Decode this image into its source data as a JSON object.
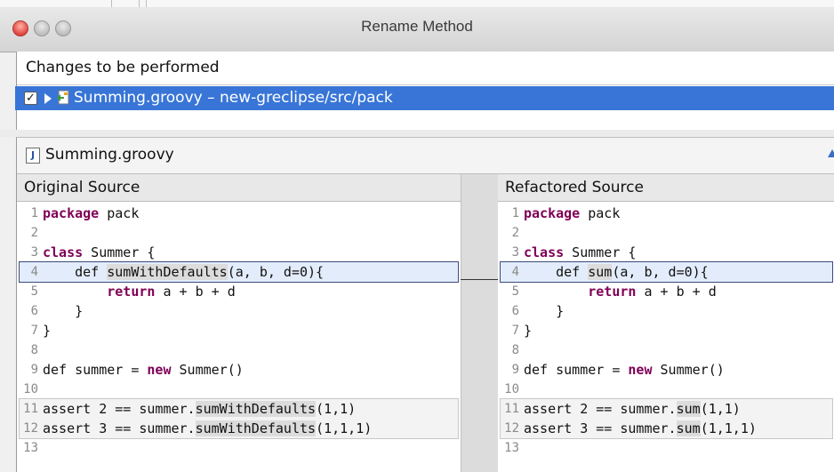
{
  "window": {
    "title": "Rename Method"
  },
  "changes": {
    "header": "Changes to be performed",
    "item": {
      "checked": true,
      "label": "Summing.groovy – new-greclipse/src/pack",
      "icon": "groovy-file-icon"
    }
  },
  "compare": {
    "file_label": "Summing.groovy",
    "left_title": "Original Source",
    "right_title": "Refactored Source",
    "left_lines": [
      {
        "n": "1",
        "parts": [
          [
            "package",
            "kw"
          ],
          [
            " pack",
            ""
          ]
        ]
      },
      {
        "n": "2",
        "parts": []
      },
      {
        "n": "3",
        "parts": [
          [
            "class",
            "kw"
          ],
          [
            " Summer {",
            ""
          ]
        ]
      },
      {
        "n": "4",
        "parts": [
          [
            "    def ",
            ""
          ],
          [
            "sumWithDefaults",
            "hl"
          ],
          [
            "(a, b, d=0){",
            ""
          ]
        ]
      },
      {
        "n": "5",
        "parts": [
          [
            "        ",
            ""
          ],
          [
            "return",
            "kw"
          ],
          [
            " a + b + d",
            ""
          ]
        ]
      },
      {
        "n": "6",
        "parts": [
          [
            "    }",
            ""
          ]
        ]
      },
      {
        "n": "7",
        "parts": [
          [
            "}",
            ""
          ]
        ]
      },
      {
        "n": "8",
        "parts": []
      },
      {
        "n": "9",
        "parts": [
          [
            "def summer = ",
            ""
          ],
          [
            "new",
            "kw"
          ],
          [
            " Summer()",
            ""
          ]
        ]
      },
      {
        "n": "10",
        "parts": []
      },
      {
        "n": "11",
        "parts": [
          [
            "assert 2 == summer.",
            ""
          ],
          [
            "sumWithDefaults",
            "hl"
          ],
          [
            "(1,1)",
            ""
          ]
        ]
      },
      {
        "n": "12",
        "parts": [
          [
            "assert 3 == summer.",
            ""
          ],
          [
            "sumWithDefaults",
            "hl"
          ],
          [
            "(1,1,1)",
            ""
          ]
        ]
      },
      {
        "n": "13",
        "parts": []
      }
    ],
    "right_lines": [
      {
        "n": "1",
        "parts": [
          [
            "package",
            "kw"
          ],
          [
            " pack",
            ""
          ]
        ]
      },
      {
        "n": "2",
        "parts": []
      },
      {
        "n": "3",
        "parts": [
          [
            "class",
            "kw"
          ],
          [
            " Summer {",
            ""
          ]
        ]
      },
      {
        "n": "4",
        "parts": [
          [
            "    def ",
            ""
          ],
          [
            "sum",
            "hl"
          ],
          [
            "(a, b, d=0){",
            ""
          ]
        ]
      },
      {
        "n": "5",
        "parts": [
          [
            "        ",
            ""
          ],
          [
            "return",
            "kw"
          ],
          [
            " a + b + d",
            ""
          ]
        ]
      },
      {
        "n": "6",
        "parts": [
          [
            "    }",
            ""
          ]
        ]
      },
      {
        "n": "7",
        "parts": [
          [
            "}",
            ""
          ]
        ]
      },
      {
        "n": "8",
        "parts": []
      },
      {
        "n": "9",
        "parts": [
          [
            "def summer = ",
            ""
          ],
          [
            "new",
            "kw"
          ],
          [
            " Summer()",
            ""
          ]
        ]
      },
      {
        "n": "10",
        "parts": []
      },
      {
        "n": "11",
        "parts": [
          [
            "assert 2 == summer.",
            ""
          ],
          [
            "sum",
            "hl"
          ],
          [
            "(1,1)",
            ""
          ]
        ]
      },
      {
        "n": "12",
        "parts": [
          [
            "assert 3 == summer.",
            ""
          ],
          [
            "sum",
            "hl"
          ],
          [
            "(1,1,1)",
            ""
          ]
        ]
      },
      {
        "n": "13",
        "parts": []
      }
    ]
  }
}
